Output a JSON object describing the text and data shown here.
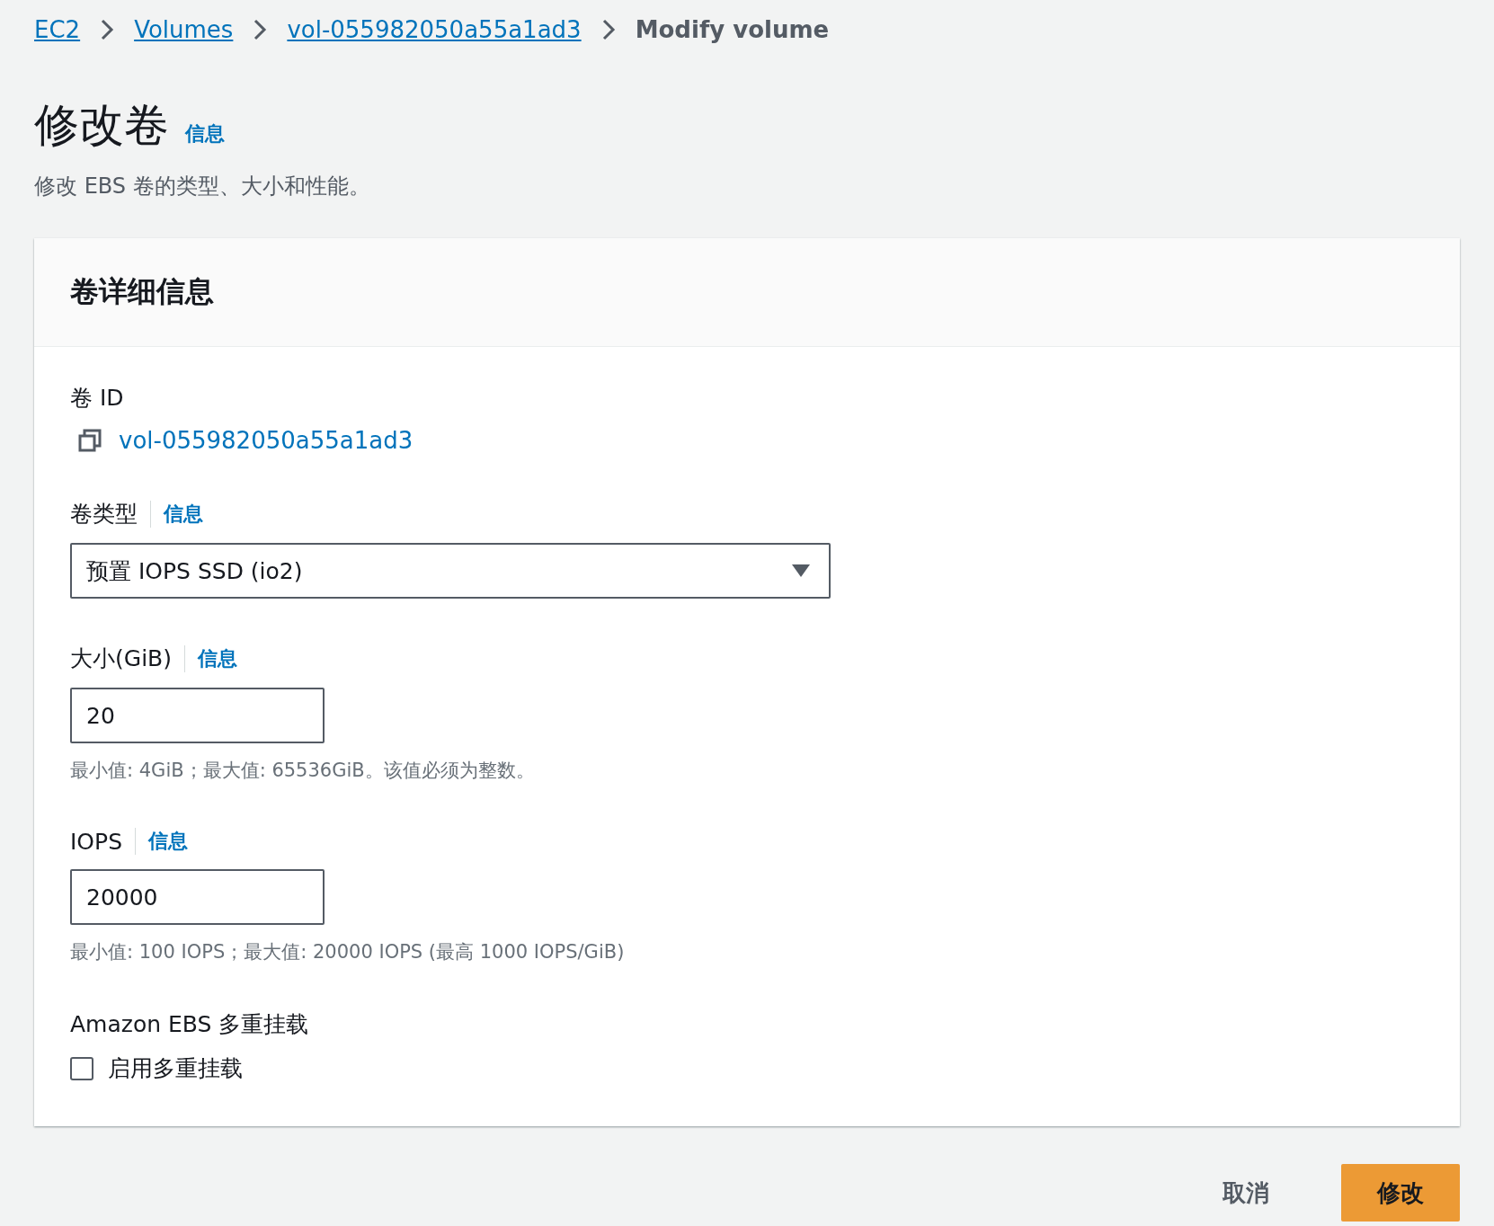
{
  "breadcrumbs": [
    {
      "label": "EC2",
      "link": true
    },
    {
      "label": "Volumes",
      "link": true
    },
    {
      "label": "vol-055982050a55a1ad3",
      "link": true
    },
    {
      "label": "Modify volume",
      "link": false
    }
  ],
  "title": "修改卷",
  "title_info": "信息",
  "subtitle": "修改 EBS 卷的类型、大小和性能。",
  "panel": {
    "heading": "卷详细信息",
    "fields": [
      {
        "kind": "copy",
        "label": "卷 ID",
        "value": "vol-055982050a55a1ad3"
      },
      {
        "kind": "select",
        "label": "卷类型",
        "info": "信息",
        "value": "预置 IOPS SSD (io2)"
      },
      {
        "kind": "input",
        "label": "大小(GiB)",
        "info": "信息",
        "value": "20",
        "hint": "最小值: 4GiB；最大值: 65536GiB。该值必须为整数。"
      },
      {
        "kind": "input",
        "label": "IOPS",
        "info": "信息",
        "value": "20000",
        "hint": "最小值: 100 IOPS；最大值: 20000 IOPS (最高 1000 IOPS/GiB)"
      },
      {
        "kind": "checkbox",
        "label": "Amazon EBS 多重挂载",
        "option": "启用多重挂载",
        "checked": false
      }
    ]
  },
  "buttons": [
    {
      "label": "取消",
      "primary": false
    },
    {
      "label": "修改",
      "primary": true
    }
  ]
}
